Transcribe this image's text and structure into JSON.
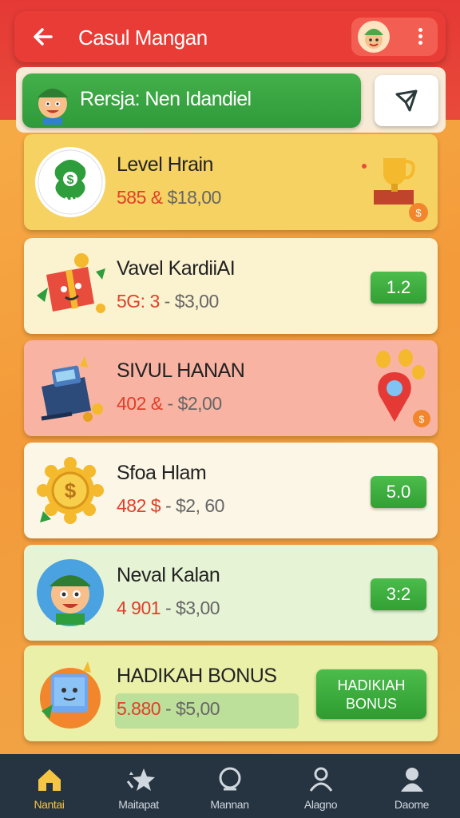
{
  "app": {
    "title": "Casul Mangan"
  },
  "banner": {
    "text": "Rersja: Nen Idandiel"
  },
  "cards": [
    {
      "name": "Level Hrain",
      "hi": "585 &",
      "rest": " $18,00",
      "bg": "#f6d262",
      "icon": "money-bag-icon",
      "deco": "trophy-icon"
    },
    {
      "name": "Vavel KardiiAI",
      "hi": "5G: 3",
      "rest": " - $3,00",
      "bg": "#fbf3cf",
      "icon": "gift-box-icon",
      "badge": "1.2"
    },
    {
      "name": "SIVUL HANAN",
      "hi": "402 &",
      "rest": " - $2,00",
      "bg": "#f8b3a3",
      "icon": "cash-register-icon",
      "deco": "location-pin-icon"
    },
    {
      "name": "Sfoa Hlam",
      "hi": "482 $",
      "rest": " - $2, 60",
      "bg": "#fcf6e6",
      "icon": "gold-coin-icon",
      "badge": "5.0"
    },
    {
      "name": "Neval Kalan",
      "hi": "4 901",
      "rest": " - $3,00",
      "bg": "#e6f3d4",
      "icon": "character-icon",
      "badge": "3:2"
    },
    {
      "name": "HADIKAH BONUS",
      "hi": "5.880",
      "rest": " - $5,00",
      "bg": "#eaf0a8",
      "icon": "robot-box-icon",
      "button": "HADIKIAH BONUS"
    }
  ],
  "nav": [
    {
      "label": "Nantai",
      "icon": "home-icon",
      "active": true
    },
    {
      "label": "Maitapat",
      "icon": "stars-icon",
      "active": false
    },
    {
      "label": "Mannan",
      "icon": "search-icon",
      "active": false
    },
    {
      "label": "Alagno",
      "icon": "user-lock-icon",
      "active": false
    },
    {
      "label": "Daome",
      "icon": "profile-icon",
      "active": false
    }
  ],
  "colors": {
    "appbar": "#ea3c36",
    "banner": "#3aa844",
    "badge": "#3caf3e",
    "nav": "#263340",
    "active": "#f7c544"
  }
}
